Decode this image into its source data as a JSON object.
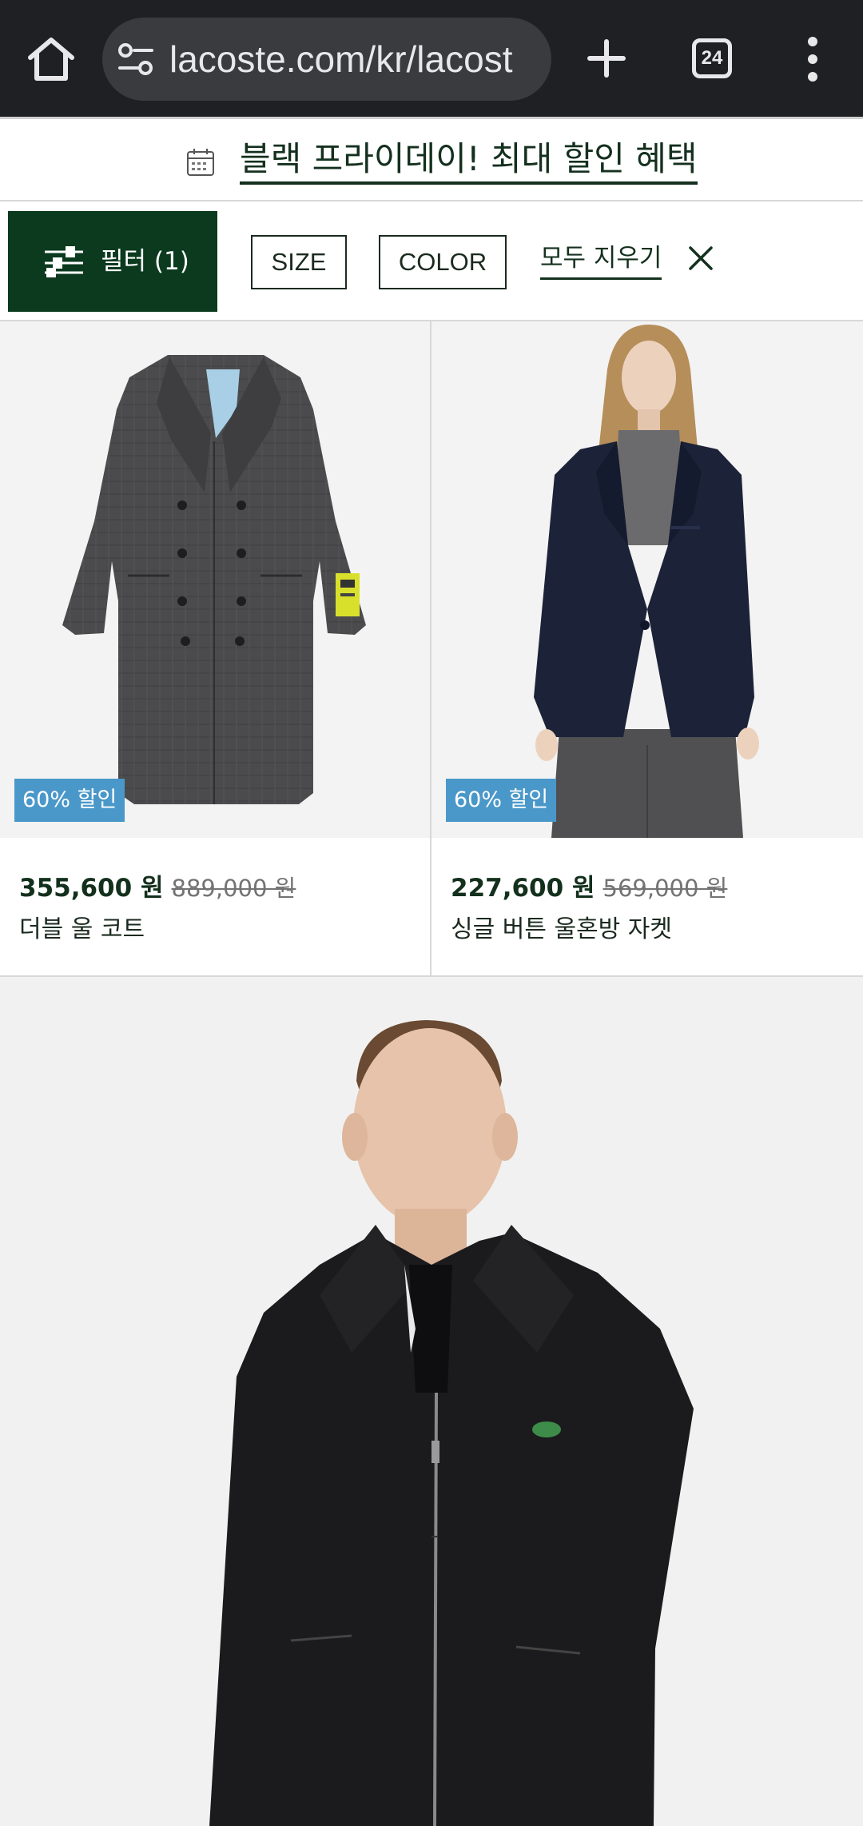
{
  "browser": {
    "url": "lacoste.com/kr/lacost",
    "tab_count": "24"
  },
  "promo": {
    "text": "블랙 프라이데이! 최대 할인 혜택"
  },
  "filters": {
    "filter_label": "필터 (1)",
    "chips": [
      "SIZE",
      "COLOR"
    ],
    "clear_all": "모두 지우기"
  },
  "products": [
    {
      "name": "더블 울 코트",
      "price": "355,600 원",
      "original_price": "889,000 원",
      "badge": "60% 할인"
    },
    {
      "name": "싱글 버튼 울혼방 자켓",
      "price": "227,600 원",
      "original_price": "569,000 원",
      "badge": "60% 할인"
    }
  ],
  "colors": {
    "brand_green": "#0b3a1e",
    "badge_blue": "#4a98c9",
    "chrome_bg": "#1f2023"
  }
}
